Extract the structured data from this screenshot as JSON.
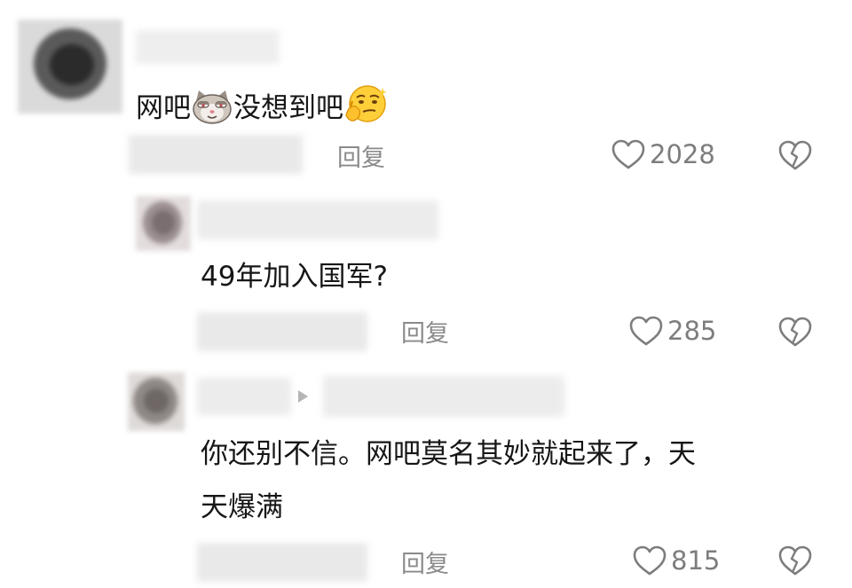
{
  "comments": [
    {
      "text_a": "网吧",
      "text_b": "没想到吧",
      "emoji_1": "cat-face-icon",
      "emoji_2": "thinking-face-icon",
      "reply_label": "回复",
      "like_count": "2028"
    },
    {
      "text": "49年加入国军?",
      "reply_label": "回复",
      "like_count": "285"
    },
    {
      "line1": "你还别不信。网吧莫名其妙就起来了，天",
      "line2": "天爆满",
      "reply_label": "回复",
      "like_count": "815"
    }
  ],
  "icons": {
    "like": "heart-outline-icon",
    "dislike": "broken-heart-icon",
    "reply_to": "play-arrow-icon"
  },
  "colors": {
    "text": "#161616",
    "secondary": "#8a8a8a",
    "icon": "#7d7d7d"
  }
}
